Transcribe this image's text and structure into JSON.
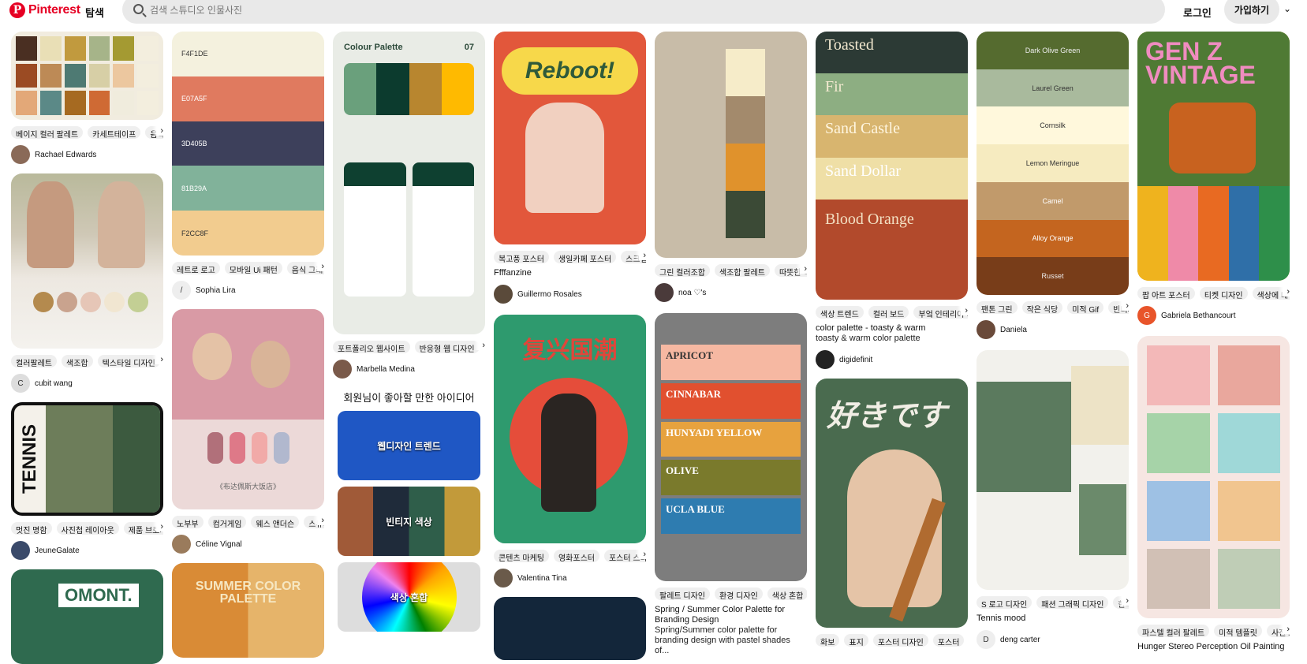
{
  "header": {
    "brand": "Pinterest",
    "explore": "탐색",
    "search_placeholder": "검색 스튜디오 인물사진",
    "login": "로그인",
    "signup": "가입하기"
  },
  "colors": {
    "brand": "#e60023"
  },
  "columns": [
    {
      "pins": [
        {
          "tags": [
            "베이지 컬러 팔레트",
            "카세트테이프",
            "음식 포"
          ],
          "user": "Rachael Edwards"
        },
        {
          "tags": [
            "컬러팔레트",
            "색조합",
            "텍스타일 디자인"
          ],
          "user": "cubit wang",
          "avatar_letter": "C"
        },
        {
          "tags": [
            "멋진 명함",
            "사진첩 레이아웃",
            "제품 브로셔"
          ],
          "user": "JeuneGalate",
          "image_text": "TENNIS"
        },
        {
          "image_text": "OMONT."
        }
      ]
    },
    {
      "pins": [
        {
          "codes": [
            "F4F1DE",
            "E07A5F",
            "3D405B",
            "81B29A",
            "F2CC8F"
          ],
          "tags": [
            "레트로 로고",
            "모바일 Ui 패턴",
            "음식 그래픽"
          ],
          "user": "Sophia Lira",
          "avatar_letter": "/"
        },
        {
          "tags": [
            "노부부",
            "컴거게임",
            "웨스 앤더슨",
            "스튜디오"
          ],
          "user": "Céline Vignal",
          "caption": "《布达佩斯大饭店》"
        },
        {
          "image_text": "SUMMER COLOR PALETTE"
        }
      ]
    },
    {
      "pins": [
        {
          "heading": "Colour Palette",
          "number": "07",
          "tags": [
            "포트폴리오 웹사이트",
            "반응형 웹 디자인",
            "모"
          ],
          "user": "Marbella Medina"
        }
      ],
      "ideas_title": "회원님이 좋아할 만한 아이디어",
      "ideas": [
        "웹디자인 트렌드",
        "빈티지 색상",
        "색상 혼합"
      ]
    },
    {
      "pins": [
        {
          "image_text": "Reboot!",
          "tags": [
            "복고풍 포스터",
            "생일카페 포스터",
            "스크랩북"
          ],
          "title": "Ffffanzine",
          "user": "Guillermo Rosales"
        },
        {
          "tags": [
            "콘텐츠 마케팅",
            "영화포스터",
            "포스터 스타일"
          ],
          "user": "Valentina Tina",
          "image_text": "复兴国潮"
        }
      ]
    },
    {
      "pins": [
        {
          "tags": [
            "그린 컬러조합",
            "색조합 팔레트",
            "따뜻한 색조"
          ],
          "user": "noa ♡'s"
        },
        {
          "names": [
            "APRICOT",
            "CINNABAR",
            "HUNYADI YELLOW",
            "OLIVE",
            "UCLA BLUE"
          ],
          "tags": [
            "팔레트 디자인",
            "환경 디자인",
            "색상 혼합"
          ],
          "title": "Spring / Summer Color Palette for Branding Design",
          "desc": "Spring/Summer color palette for branding design with pastel shades of..."
        }
      ]
    },
    {
      "pins": [
        {
          "names": [
            "Toasted",
            "Fir",
            "Sand Castle",
            "Sand Dollar",
            "Blood Orange"
          ],
          "tags": [
            "색상 트렌드",
            "컬러 보드",
            "부엌 인테리어 디자인"
          ],
          "title": "color palette - toasty & warm",
          "desc": "toasty & warm color palette",
          "user": "digidefinit"
        },
        {
          "image_text": "好きです",
          "tags": [
            "화보",
            "표지",
            "포스터 디자인",
            "포스터"
          ]
        }
      ]
    },
    {
      "pins": [
        {
          "names": [
            "Dark Olive Green",
            "Laurel Green",
            "Cornsilk",
            "Lemon Meringue",
            "Camel",
            "Alloy Orange",
            "Russet"
          ],
          "tags": [
            "팬톤 그린",
            "작은 식당",
            "미적 Gif",
            "빈티지"
          ],
          "user": "Daniela"
        },
        {
          "tags": [
            "S 로고 디자인",
            "패션 그래픽 디자인",
            "한국"
          ],
          "title": "Tennis mood",
          "user": "deng carter",
          "avatar_letter": "D"
        }
      ]
    },
    {
      "pins": [
        {
          "image_text": "GEN Z VINTAGE",
          "tags": [
            "팝 아트 포스터",
            "티켓 디자인",
            "색상에 대한"
          ],
          "user": "Gabriela Bethancourt",
          "avatar_letter": "G"
        },
        {
          "tags": [
            "파스텔 컬러 팔레트",
            "미적 템플릿",
            "사진 그"
          ],
          "title": "Hunger Stereo Perception Oil Painting"
        }
      ]
    }
  ]
}
